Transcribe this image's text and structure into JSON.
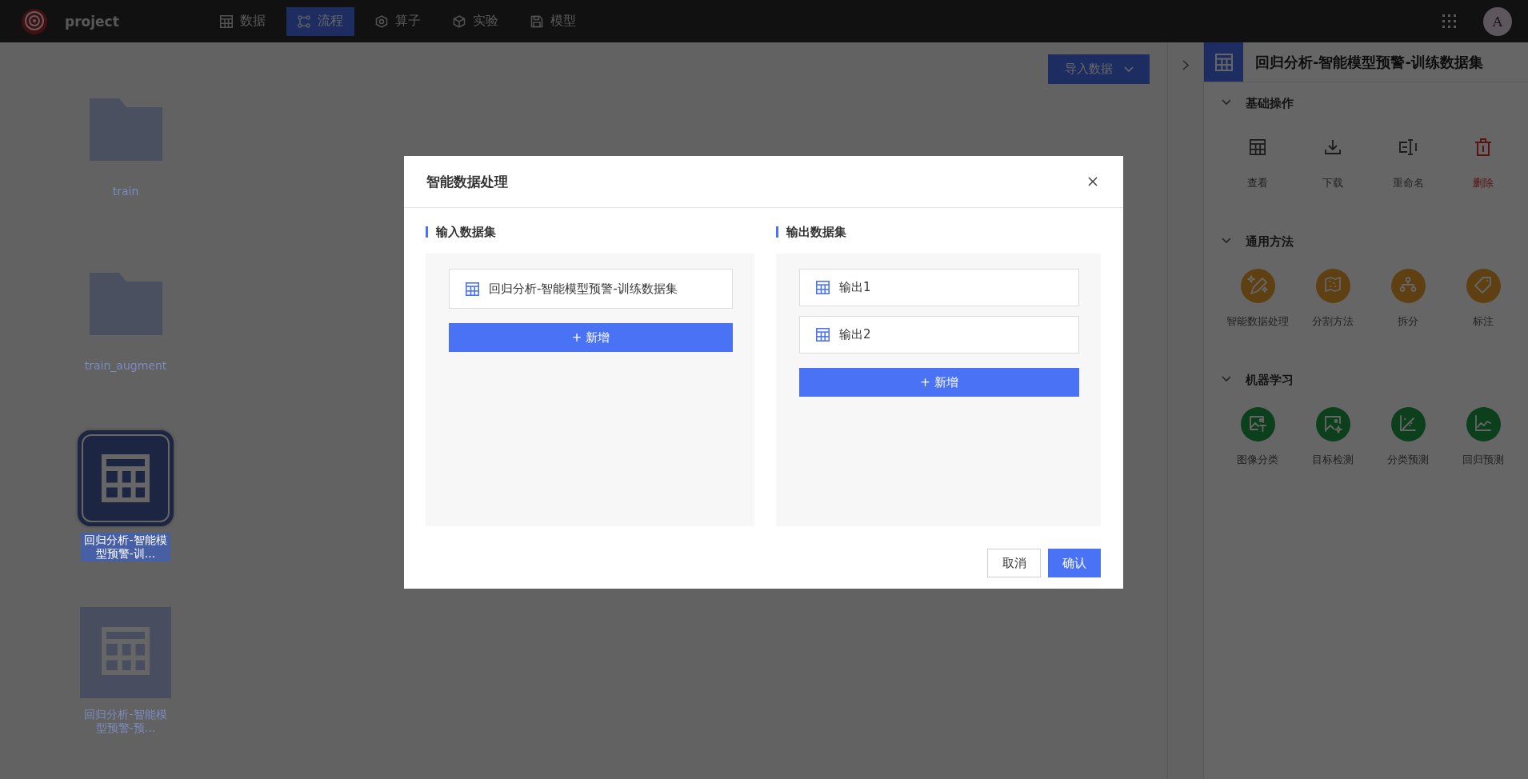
{
  "app": {
    "name": "project",
    "avatar": "A"
  },
  "nav": [
    {
      "label": "数据",
      "selected": false
    },
    {
      "label": "流程",
      "selected": true
    },
    {
      "label": "算子",
      "selected": false
    },
    {
      "label": "实验",
      "selected": false
    },
    {
      "label": "模型",
      "selected": false
    }
  ],
  "toolbar": {
    "import_button": "导入数据"
  },
  "files": [
    {
      "kind": "folder",
      "name": "train",
      "selected": false
    },
    {
      "kind": "folder",
      "name": "train_augment",
      "selected": false
    },
    {
      "kind": "dataset",
      "name": "回归分析-智能模型预警-训...",
      "selected": true
    },
    {
      "kind": "dataset",
      "name": "回归分析-智能模型预警-预...",
      "selected": false
    }
  ],
  "panel": {
    "title": "回归分析-智能模型预警-训练数据集",
    "sections": [
      {
        "title": "基础操作",
        "expanded": true,
        "actions": [
          {
            "label": "查看",
            "kind": "plain"
          },
          {
            "label": "下载",
            "kind": "plain"
          },
          {
            "label": "重命名",
            "kind": "plain"
          },
          {
            "label": "删除",
            "kind": "danger"
          }
        ]
      },
      {
        "title": "通用方法",
        "expanded": true,
        "actions": [
          {
            "label": "智能数据处理",
            "kind": "method"
          },
          {
            "label": "分割方法",
            "kind": "method"
          },
          {
            "label": "拆分",
            "kind": "method"
          },
          {
            "label": "标注",
            "kind": "method"
          }
        ]
      },
      {
        "title": "机器学习",
        "expanded": true,
        "actions": [
          {
            "label": "图像分类",
            "kind": "ml"
          },
          {
            "label": "目标检测",
            "kind": "ml"
          },
          {
            "label": "分类预测",
            "kind": "ml"
          },
          {
            "label": "回归预测",
            "kind": "ml"
          }
        ]
      }
    ]
  },
  "dialog": {
    "title": "智能数据处理",
    "input": {
      "title": "输入数据集",
      "items": [
        "回归分析-智能模型预警-训练数据集"
      ],
      "add_button": "+ 新增"
    },
    "output": {
      "title": "输出数据集",
      "items": [
        "输出1",
        "输出2"
      ],
      "add_button": "+ 新增"
    },
    "buttons": [
      {
        "label": "取消",
        "kind": "secondary"
      },
      {
        "label": "确认",
        "kind": "primary"
      }
    ]
  }
}
